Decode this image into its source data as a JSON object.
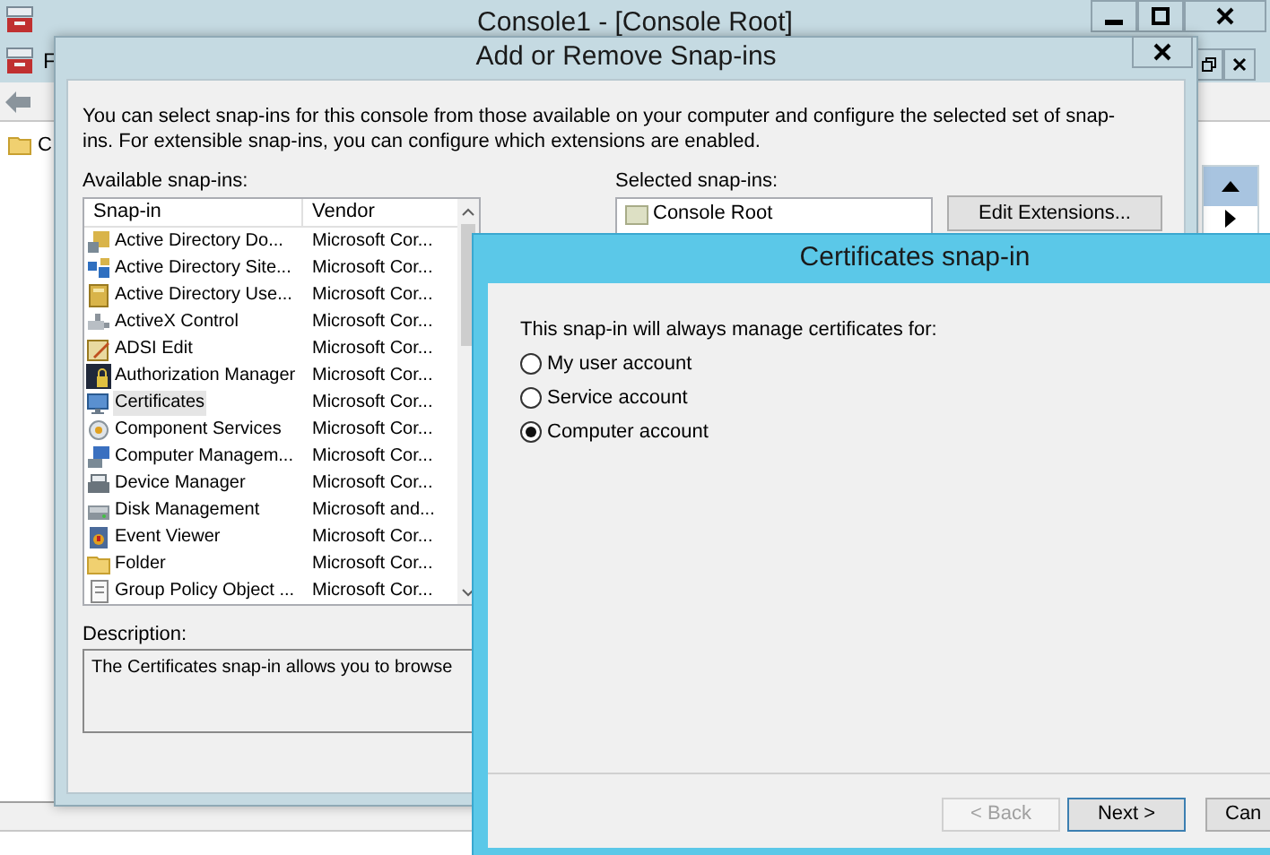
{
  "console_window": {
    "title": "Console1 - [Console Root]",
    "menu_text": "F",
    "tree_item": "C"
  },
  "dialog": {
    "title": "Add or Remove Snap-ins",
    "intro": "You can select snap-ins for this console from those available on your computer and configure the selected set of snap-ins. For extensible snap-ins, you can configure which extensions are enabled.",
    "available_label": "Available snap-ins:",
    "columns": [
      "Snap-in",
      "Vendor"
    ],
    "snapins": [
      {
        "name": "Active Directory Do...",
        "vendor": "Microsoft Cor...",
        "selected": false
      },
      {
        "name": "Active Directory Site...",
        "vendor": "Microsoft Cor...",
        "selected": false
      },
      {
        "name": "Active Directory Use...",
        "vendor": "Microsoft Cor...",
        "selected": false
      },
      {
        "name": "ActiveX Control",
        "vendor": "Microsoft Cor...",
        "selected": false
      },
      {
        "name": "ADSI Edit",
        "vendor": "Microsoft Cor...",
        "selected": false
      },
      {
        "name": "Authorization Manager",
        "vendor": "Microsoft Cor...",
        "selected": false
      },
      {
        "name": "Certificates",
        "vendor": "Microsoft Cor...",
        "selected": true
      },
      {
        "name": "Component Services",
        "vendor": "Microsoft Cor...",
        "selected": false
      },
      {
        "name": "Computer Managem...",
        "vendor": "Microsoft Cor...",
        "selected": false
      },
      {
        "name": "Device Manager",
        "vendor": "Microsoft Cor...",
        "selected": false
      },
      {
        "name": "Disk Management",
        "vendor": "Microsoft and...",
        "selected": false
      },
      {
        "name": "Event Viewer",
        "vendor": "Microsoft Cor...",
        "selected": false
      },
      {
        "name": "Folder",
        "vendor": "Microsoft Cor...",
        "selected": false
      },
      {
        "name": "Group Policy Object ...",
        "vendor": "Microsoft Cor...",
        "selected": false
      }
    ],
    "selected_label": "Selected snap-ins:",
    "selected_items": [
      "Console Root"
    ],
    "edit_extensions_button": "Edit Extensions...",
    "description_label": "Description:",
    "description": "The Certificates snap-in allows you to browse"
  },
  "wizard": {
    "title": "Certificates snap-in",
    "prompt": "This snap-in will always manage certificates for:",
    "options": [
      {
        "label": "My user account",
        "selected": false
      },
      {
        "label": "Service account",
        "selected": false
      },
      {
        "label": "Computer account",
        "selected": true
      }
    ],
    "buttons": [
      {
        "label": "< Back",
        "disabled": true
      },
      {
        "label": "Next >",
        "disabled": false
      },
      {
        "label": "Can",
        "disabled": false
      }
    ]
  }
}
